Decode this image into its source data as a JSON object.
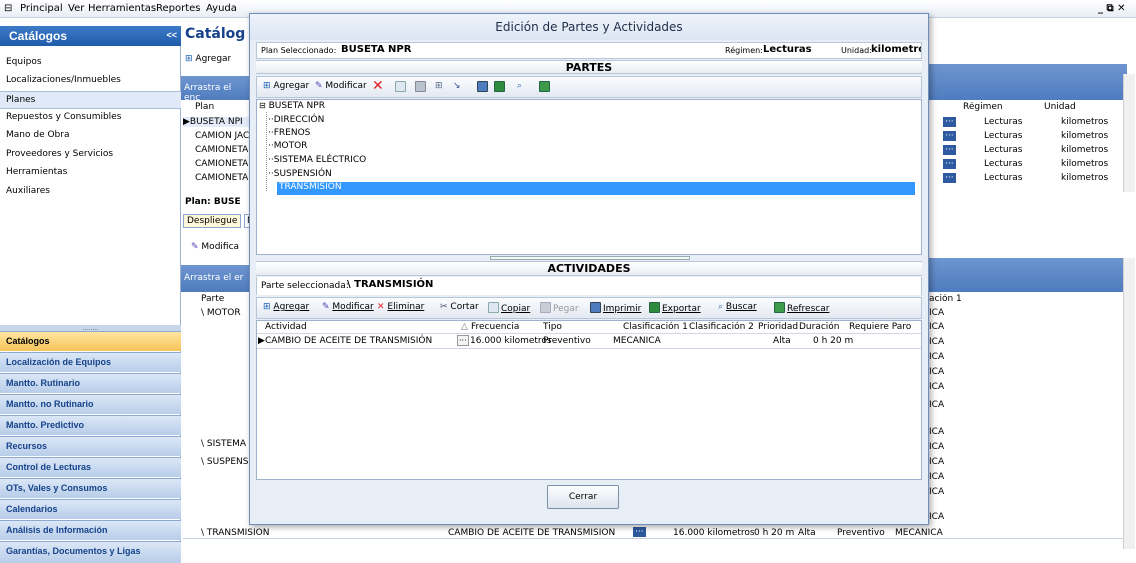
{
  "menubar": {
    "items": [
      "Principal",
      "Ver",
      "Herramientas",
      "Reportes",
      "Ayuda"
    ],
    "window_controls": "_ ⧉ ✕"
  },
  "sidebar": {
    "title": "Catálogos",
    "collapse": "<<",
    "items": [
      {
        "label": "Equipos",
        "selected": false
      },
      {
        "label": "Localizaciones/Inmuebles",
        "selected": false
      },
      {
        "label": "Planes",
        "selected": true
      },
      {
        "label": "Repuestos y Consumibles",
        "selected": false
      },
      {
        "label": "Mano de Obra",
        "selected": false
      },
      {
        "label": "Proveedores y Servicios",
        "selected": false
      },
      {
        "label": "Herramientas",
        "selected": false
      },
      {
        "label": "Auxiliares",
        "selected": false
      }
    ],
    "grip": "........",
    "nav": [
      {
        "label": "Catálogos",
        "active": true
      },
      {
        "label": "Localización de Equipos",
        "active": false
      },
      {
        "label": "Mantto. Rutinario",
        "active": false
      },
      {
        "label": "Mantto. no Rutinario",
        "active": false
      },
      {
        "label": "Mantto. Predictivo",
        "active": false
      },
      {
        "label": "Recursos",
        "active": false
      },
      {
        "label": "Control de Lecturas",
        "active": false
      },
      {
        "label": "OTs, Vales y Consumos",
        "active": false
      },
      {
        "label": "Calendarios",
        "active": false
      },
      {
        "label": "Análisis de Información",
        "active": false
      },
      {
        "label": "Garantías, Documentos y Ligas",
        "active": false
      }
    ]
  },
  "background": {
    "title": "Catálog",
    "agregar": "Agregar",
    "drag_hint_top": "Arrastra el enc",
    "plan_header": "Plan",
    "plans": [
      "BUSETA NPI",
      "CAMIÓN JAC",
      "CAMIONETA",
      "CAMIONETA",
      "CAMIONETA"
    ],
    "regimen_header": "Régimen",
    "unidad_header": "Unidad",
    "regimen_values": [
      "Lecturas",
      "Lecturas",
      "Lecturas",
      "Lecturas",
      "Lecturas"
    ],
    "unidad_values": [
      "kilometros",
      "kilometros",
      "kilometros",
      "kilometros",
      "kilometros"
    ],
    "plan_label": "Plan: BUSE",
    "tab_despliegue": "Despliegue",
    "tab_n": "N",
    "modifica": "Modifica",
    "drag_hint_bottom": "Arrastra el er",
    "parte_header": "Parte",
    "clasif_header": "ación 1",
    "parte_rows": [
      "\\ MOTOR",
      "\\ SISTEMA",
      "\\ SUSPENS"
    ],
    "clasif_values": [
      "ICA",
      "ICA",
      "ICA",
      "ICA",
      "ICA",
      "ICA",
      "ICA",
      "ICA",
      "ICA",
      "ICA",
      "ICA",
      "ICA",
      "ICA",
      "ICA"
    ],
    "last_row": {
      "parte": "\\ TRANSMISIÓN",
      "actividad": "CAMBIO DE ACEITE DE TRANSMISIÓN",
      "frecuencia": "16.000 kilometros",
      "duracion": "0 h 20 m",
      "prioridad": "Alta",
      "tipo": "Preventivo",
      "clasif": "MECANICA"
    }
  },
  "dialog": {
    "title": "Edición de Partes y Actividades",
    "plan_label": "Plan Seleccionado:",
    "plan_value": "BUSETA NPR",
    "regimen_label": "Régimen:",
    "regimen_value": "Lecturas",
    "unidad_label": "Unidad:",
    "unidad_value": "kilometro",
    "partes_title": "PARTES",
    "partes_toolbar": {
      "agregar": "Agregar",
      "modificar": "Modificar"
    },
    "tree_root": "BUSETA NPR",
    "tree_children": [
      "DIRECCIÓN",
      "FRENOS",
      "MOTOR",
      "SISTEMA ELÉCTRICO",
      "SUSPENSIÓN",
      "TRANSMISIÓN"
    ],
    "actividades_title": "ACTIVIDADES",
    "parte_sel_label": "Parte seleccionada:",
    "parte_sel_value": "\\ TRANSMISIÓN",
    "act_toolbar": {
      "agregar": "Agregar",
      "modificar": "Modificar",
      "eliminar": "Eliminar",
      "cortar": "Cortar",
      "copiar": "Copiar",
      "pegar": "Pegar",
      "imprimir": "Imprimir",
      "exportar": "Exportar",
      "buscar": "Buscar",
      "refrescar": "Refrescar"
    },
    "columns": [
      "Actividad",
      "Frecuencia",
      "Tipo",
      "Clasificación 1",
      "Clasificación 2",
      "Prioridad",
      "Duración",
      "Requiere Paro"
    ],
    "rows": [
      {
        "actividad": "CAMBIO DE ACEITE DE TRANSMISIÓN",
        "frecuencia": "16.000 kilometros",
        "tipo": "Preventivo",
        "clasif1": "MECANICA",
        "clasif2": "",
        "prioridad": "Alta",
        "duracion": "0 h 20 m",
        "paro": ""
      }
    ],
    "close_label": "Cerrar"
  },
  "colors": {
    "sidebar_header": "#1f5ba8",
    "nav_active": "#f6c35a",
    "selection": "#3399ff",
    "band": "#4f7cbf"
  }
}
